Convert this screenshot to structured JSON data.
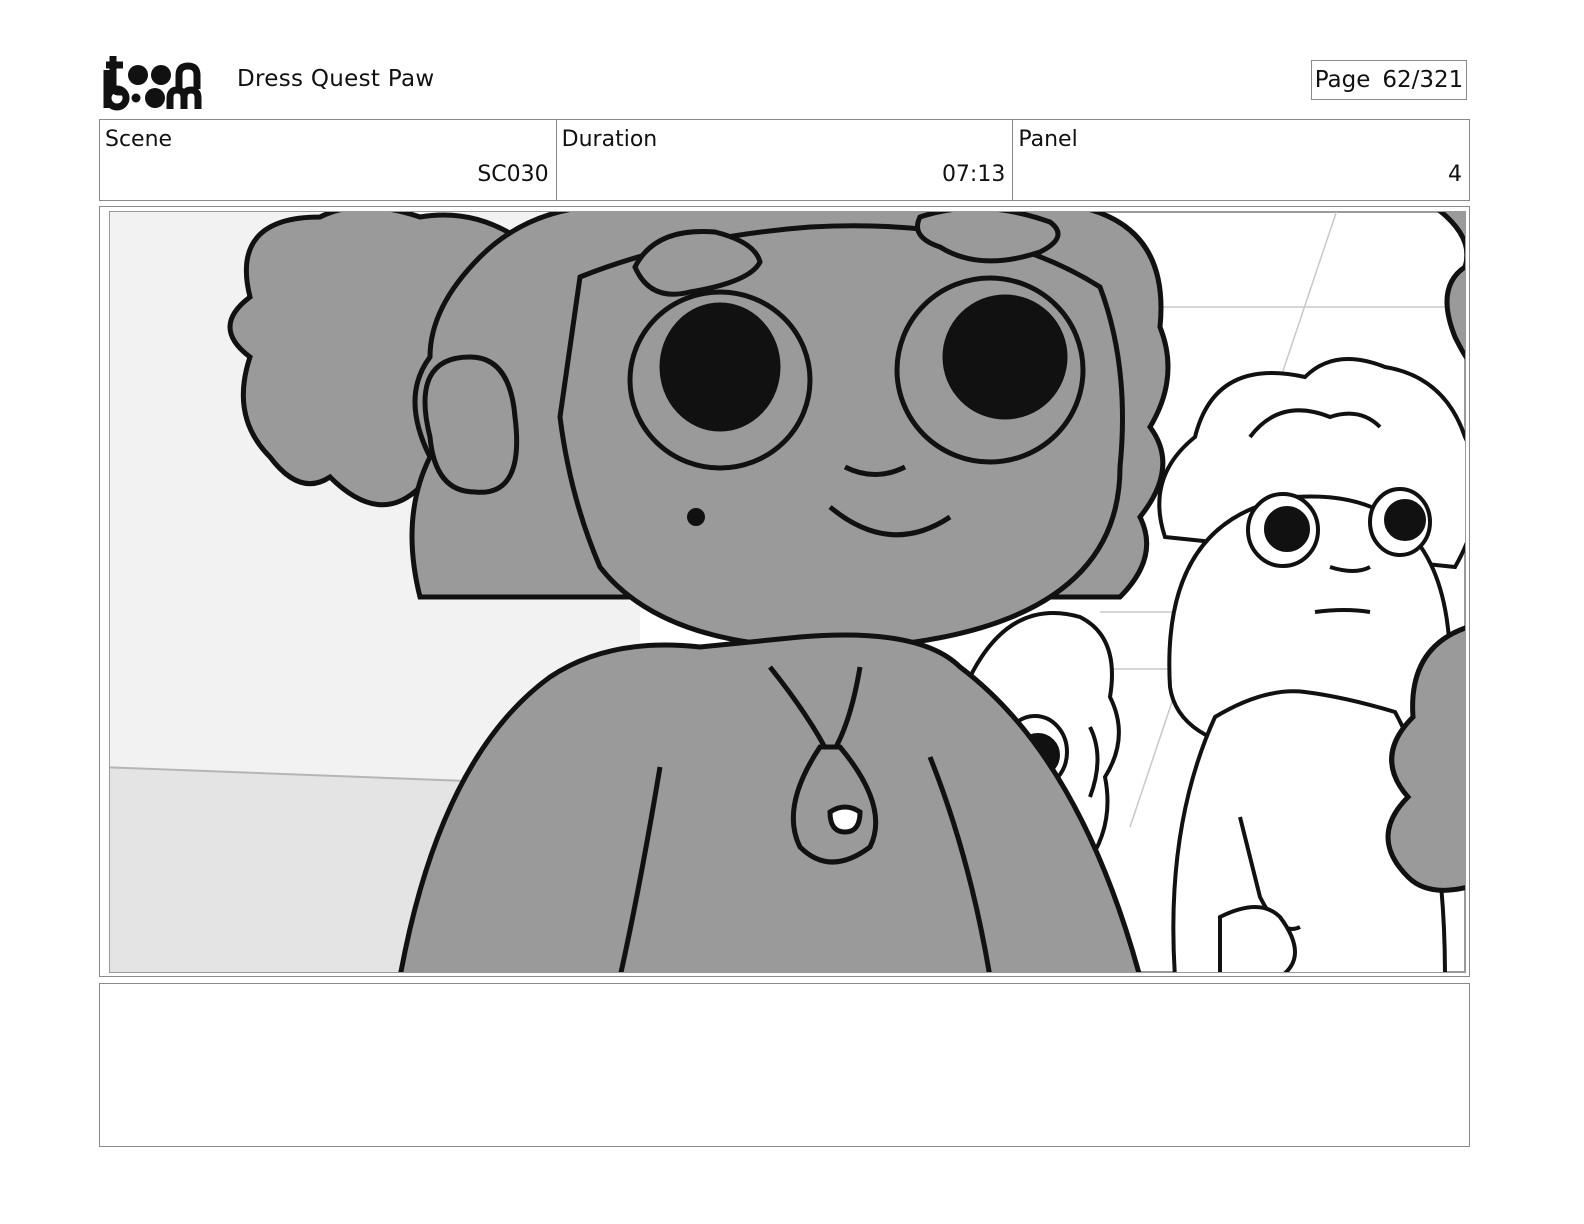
{
  "header": {
    "logo_text": "toon boom",
    "project_title": "Dress Quest Paw",
    "page_label": "Page",
    "page_number": "62/321"
  },
  "info": {
    "scene_label": "Scene",
    "scene_value": "SC030",
    "duration_label": "Duration",
    "duration_value": "07:13",
    "panel_label": "Panel",
    "panel_value": "4"
  },
  "notes": {
    "text": ""
  },
  "colors": {
    "border": "#8a8a8a",
    "character_fill": "#9a9a9a",
    "ink": "#111111",
    "background_wall": "#f2f2f2",
    "background_floor": "#e4e4e4"
  }
}
